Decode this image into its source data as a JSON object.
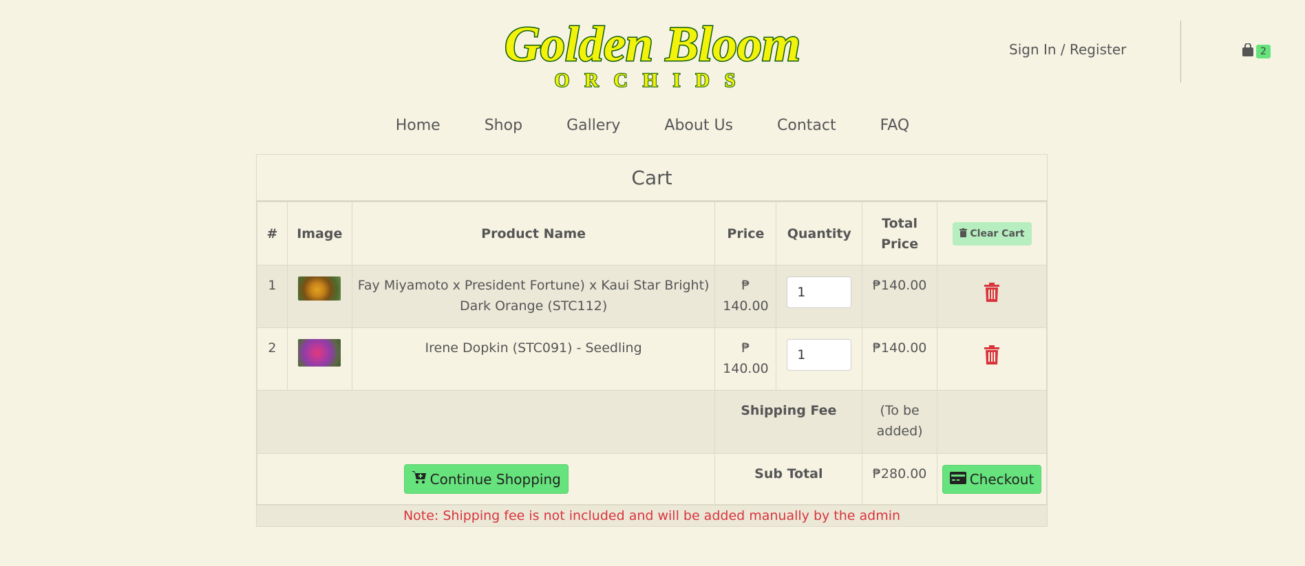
{
  "header": {
    "logo_line1": "Golden Bloom",
    "logo_line2": "ORCHIDS",
    "signin_label": "Sign In / Register",
    "cart_count": "2"
  },
  "nav": {
    "items": [
      "Home",
      "Shop",
      "Gallery",
      "About Us",
      "Contact",
      "FAQ"
    ]
  },
  "cart": {
    "title": "Cart",
    "columns": {
      "num": "#",
      "image": "Image",
      "name": "Product Name",
      "price": "Price",
      "quantity": "Quantity",
      "total_line1": "Total",
      "total_line2": "Price"
    },
    "clear_label": "Clear Cart",
    "items": [
      {
        "num": "1",
        "name_line1": "Fay Miyamoto x President Fortune) x Kaui Star Bright)",
        "name_line2": "Dark Orange (STC112)",
        "price_symbol": "₱",
        "price_value": "140.00",
        "quantity": "1",
        "total": "₱140.00"
      },
      {
        "num": "2",
        "name_line1": "Irene Dopkin (STC091) - Seedling",
        "name_line2": "",
        "price_symbol": "₱",
        "price_value": "140.00",
        "quantity": "1",
        "total": "₱140.00"
      }
    ],
    "shipping_label": "Shipping Fee",
    "shipping_value_line1": "(To be",
    "shipping_value_line2": "added)",
    "continue_label": "Continue Shopping",
    "subtotal_label": "Sub Total",
    "subtotal_value": "₱280.00",
    "checkout_label": "Checkout",
    "note": "Note: Shipping fee is not included and will be added manually by the admin"
  },
  "colors": {
    "background": "#f6f3e3",
    "accent_green": "#66e37c",
    "danger_red": "#d9343c",
    "logo_yellow": "#f2f20a",
    "logo_green": "#0c5a0c"
  }
}
